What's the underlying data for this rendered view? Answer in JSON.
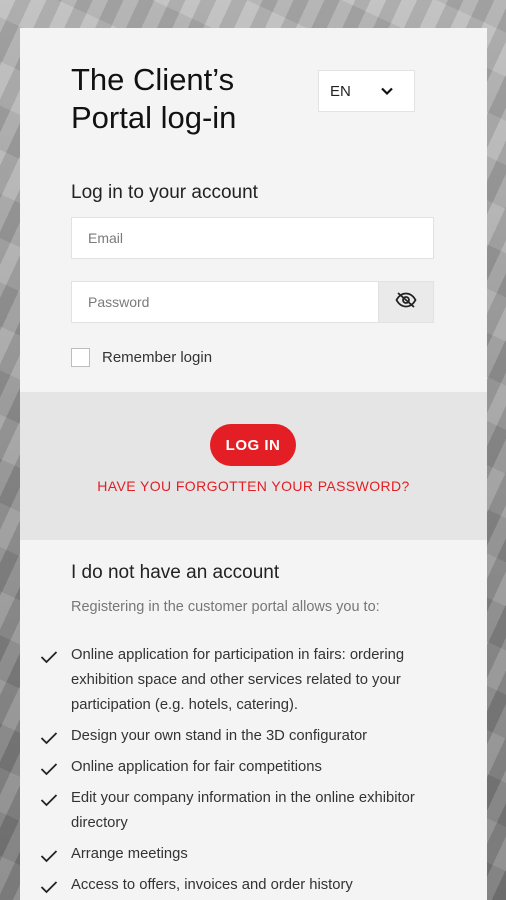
{
  "page": {
    "title": "The Client’s Portal log-in",
    "language": {
      "selected": "EN",
      "icon": "chevron-down-icon"
    }
  },
  "login": {
    "heading": "Log in to your account",
    "email_placeholder": "Email",
    "password_placeholder": "Password",
    "password_toggle_icon": "eye-off-icon",
    "remember_label": "Remember login",
    "login_button": "LOG IN",
    "forgot_link": "HAVE YOU FORGOTTEN YOUR PASSWORD?"
  },
  "register": {
    "heading": "I do not have an account",
    "intro": "Registering in the customer portal allows you to:",
    "benefits": [
      "Online application for participation in fairs: ordering exhibition space and other services related to your participation (e.g. hotels, catering).",
      "Design your own stand in the 3D configurator",
      "Online application for fair competitions",
      "Edit your company information in the online exhibitor directory",
      "Arrange meetings",
      "Access to offers, invoices and order history"
    ]
  },
  "colors": {
    "accent": "#e31e24",
    "card": "#f4f4f4",
    "band": "#e5e5e5"
  }
}
